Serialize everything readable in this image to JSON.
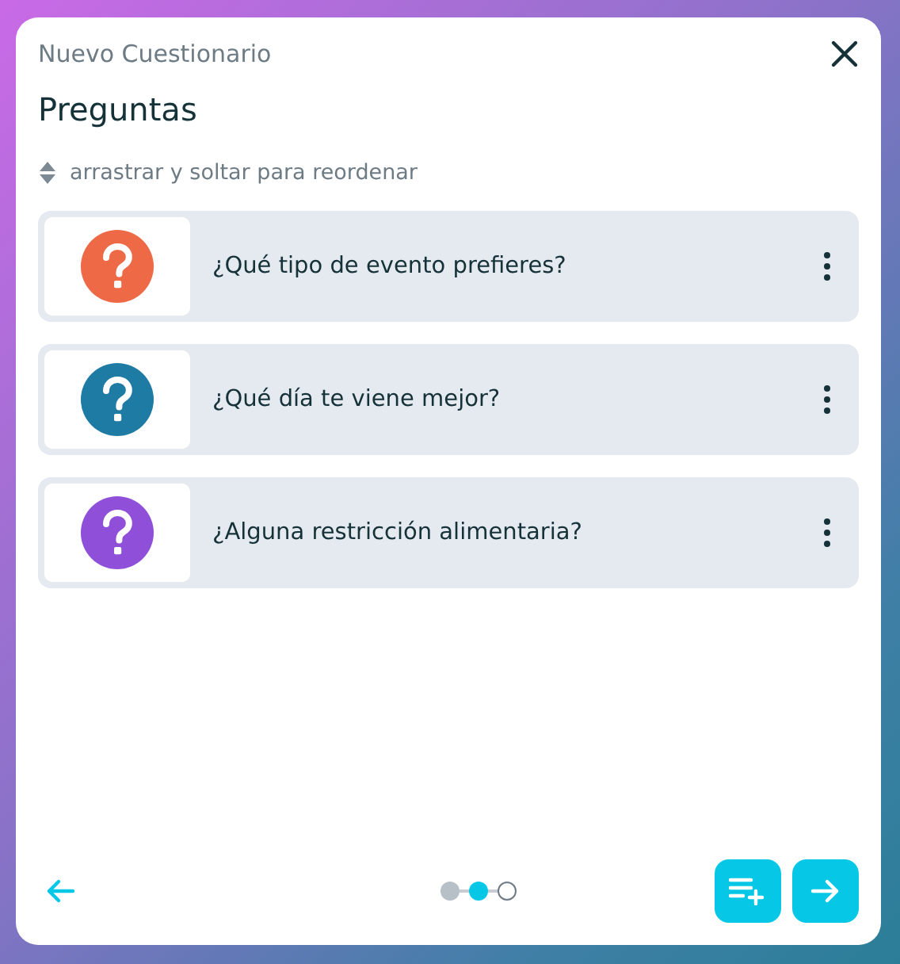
{
  "dialog": {
    "subtitle": "Nuevo Cuestionario",
    "title": "Preguntas",
    "hint": "arrastrar y soltar para reordenar"
  },
  "questions": [
    {
      "text": "¿Qué tipo de evento prefieres?",
      "color": "#ee6a47"
    },
    {
      "text": "¿Qué día te viene mejor?",
      "color": "#1e7ba3"
    },
    {
      "text": "¿Alguna restricción alimentaria?",
      "color": "#8f4fd8"
    }
  ],
  "steps": [
    {
      "kind": "done"
    },
    {
      "kind": "current"
    },
    {
      "kind": "todo"
    }
  ]
}
